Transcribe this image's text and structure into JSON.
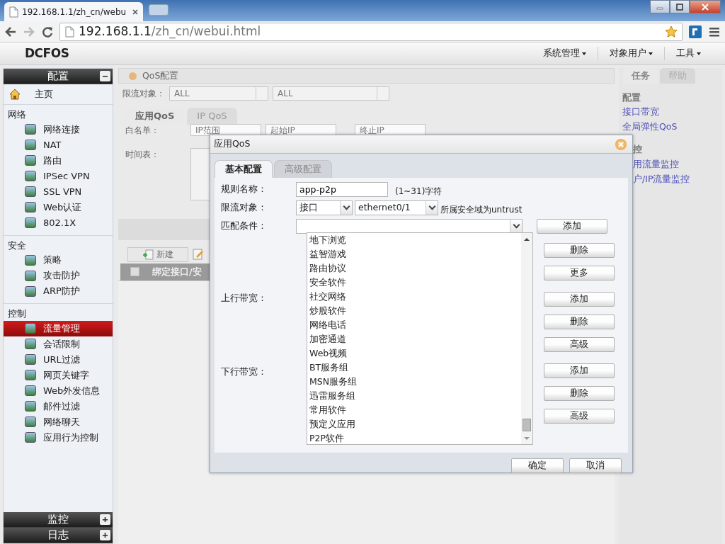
{
  "browser": {
    "tab_title": "192.168.1.1/zh_cn/webu",
    "url_host": "192.168.1.1",
    "url_path": "/zh_cn/webui.html"
  },
  "header": {
    "logo": "DCFOS",
    "menus": [
      "系统管理",
      "对象用户",
      "工具"
    ]
  },
  "sidebar": {
    "sections": [
      {
        "title": "配置",
        "expanded": true,
        "home": {
          "label": "主页",
          "selected": false
        },
        "groups": [
          {
            "title": "网络",
            "items": [
              {
                "label": "网络连接",
                "selected": false
              },
              {
                "label": "NAT",
                "selected": false
              },
              {
                "label": "路由",
                "selected": false
              },
              {
                "label": "IPSec VPN",
                "selected": false
              },
              {
                "label": "SSL VPN",
                "selected": false
              },
              {
                "label": "Web认证",
                "selected": false
              },
              {
                "label": "802.1X",
                "selected": false
              }
            ]
          },
          {
            "title": "安全",
            "items": [
              {
                "label": "策略",
                "selected": false
              },
              {
                "label": "攻击防护",
                "selected": false
              },
              {
                "label": "ARP防护",
                "selected": false
              }
            ]
          },
          {
            "title": "控制",
            "items": [
              {
                "label": "流量管理",
                "selected": true
              },
              {
                "label": "会话限制",
                "selected": false
              },
              {
                "label": "URL过滤",
                "selected": false
              },
              {
                "label": "网页关键字",
                "selected": false
              },
              {
                "label": "Web外发信息",
                "selected": false
              },
              {
                "label": "邮件过滤",
                "selected": false
              },
              {
                "label": "网络聊天",
                "selected": false
              },
              {
                "label": "应用行为控制",
                "selected": false
              }
            ]
          }
        ]
      },
      {
        "title": "监控",
        "expanded": false
      },
      {
        "title": "日志",
        "expanded": false
      }
    ]
  },
  "qos_panel": {
    "title": "QoS配置",
    "filter_label": "限流对象：",
    "filters": [
      "ALL",
      "ALL"
    ],
    "tabs": [
      {
        "label": "应用QoS",
        "selected": true
      },
      {
        "label": "IP QoS",
        "selected": false
      }
    ],
    "whitelist_label": "白名单：",
    "whitelist_type": "IP范围",
    "start_ip": "起始IP",
    "end_ip": "终止IP",
    "schedule_label": "时间表：",
    "new_button": "新建",
    "header_checked": false,
    "table_header": "绑定接口/安"
  },
  "task_panel": {
    "tabs": [
      {
        "label": "任务",
        "selected": true
      },
      {
        "label": "帮助",
        "selected": false
      }
    ],
    "sections": [
      {
        "title": "配置",
        "links": [
          "接口带宽",
          "全局弹性QoS"
        ]
      },
      {
        "title": "控",
        "links": [
          "用流量监控",
          "户/IP流量监控"
        ]
      }
    ]
  },
  "dialog": {
    "title": "应用QoS",
    "tabs": [
      {
        "label": "基本配置",
        "selected": true
      },
      {
        "label": "高级配置",
        "selected": false
      }
    ],
    "rule_name": {
      "label": "规则名称：",
      "value": "app-p2p",
      "hint": "(1~31)字符"
    },
    "target": {
      "label": "限流对象：",
      "type": "接口",
      "interface": "ethernet0/1",
      "note": "所属安全域为untrust"
    },
    "match": {
      "label": "匹配条件：",
      "expanded": true,
      "buttons": [
        "添加",
        "删除",
        "更多"
      ],
      "options": [
        "地下浏览",
        "益智游戏",
        "路由协议",
        "安全软件",
        "社交网络",
        "炒股软件",
        "网络电话",
        "加密通道",
        "Web视频",
        "BT服务组",
        "MSN服务组",
        "迅雷服务组",
        "常用软件",
        "预定义应用",
        "P2P软件"
      ]
    },
    "upstream": {
      "label": "上行带宽：",
      "buttons": [
        "添加",
        "删除",
        "高级"
      ]
    },
    "downstream": {
      "label": "下行带宽：",
      "buttons": [
        "添加",
        "删除",
        "高级"
      ]
    },
    "footer_buttons": [
      "确定",
      "取消"
    ]
  }
}
